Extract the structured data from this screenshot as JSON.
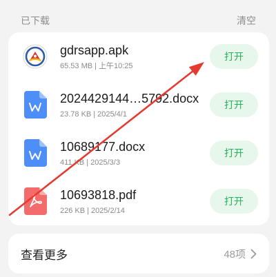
{
  "header": {
    "title": "已下载",
    "clear_label": "清空"
  },
  "meta_separator": "|",
  "downloads": [
    {
      "name": "gdrsapp.apk",
      "size": "65.53 MB",
      "date": "上午10:25",
      "icon": "app-logo-icon",
      "action_label": "打开"
    },
    {
      "name": "2024429144…5792.docx",
      "size": "23.78 KB",
      "date": "2025/4/1",
      "icon": "word-file-icon",
      "action_label": "打开"
    },
    {
      "name": "10689177.docx",
      "size": "411 KB",
      "date": "2025/3/3",
      "icon": "word-file-icon",
      "action_label": "打开"
    },
    {
      "name": "10693818.pdf",
      "size": "226 KB",
      "date": "2025/2/14",
      "icon": "pdf-file-icon",
      "action_label": "打开"
    }
  ],
  "more": {
    "label": "查看更多",
    "count": "48项",
    "icon": "chevron-right-icon"
  },
  "colors": {
    "background": "#f3f3f3",
    "card": "#ffffff",
    "open_button_bg": "#e7f7ec",
    "open_button_text": "#25b15b",
    "word_icon": "#4d8ef8",
    "pdf_icon": "#f36b6b",
    "annotation_arrow": "#e53a2f"
  }
}
